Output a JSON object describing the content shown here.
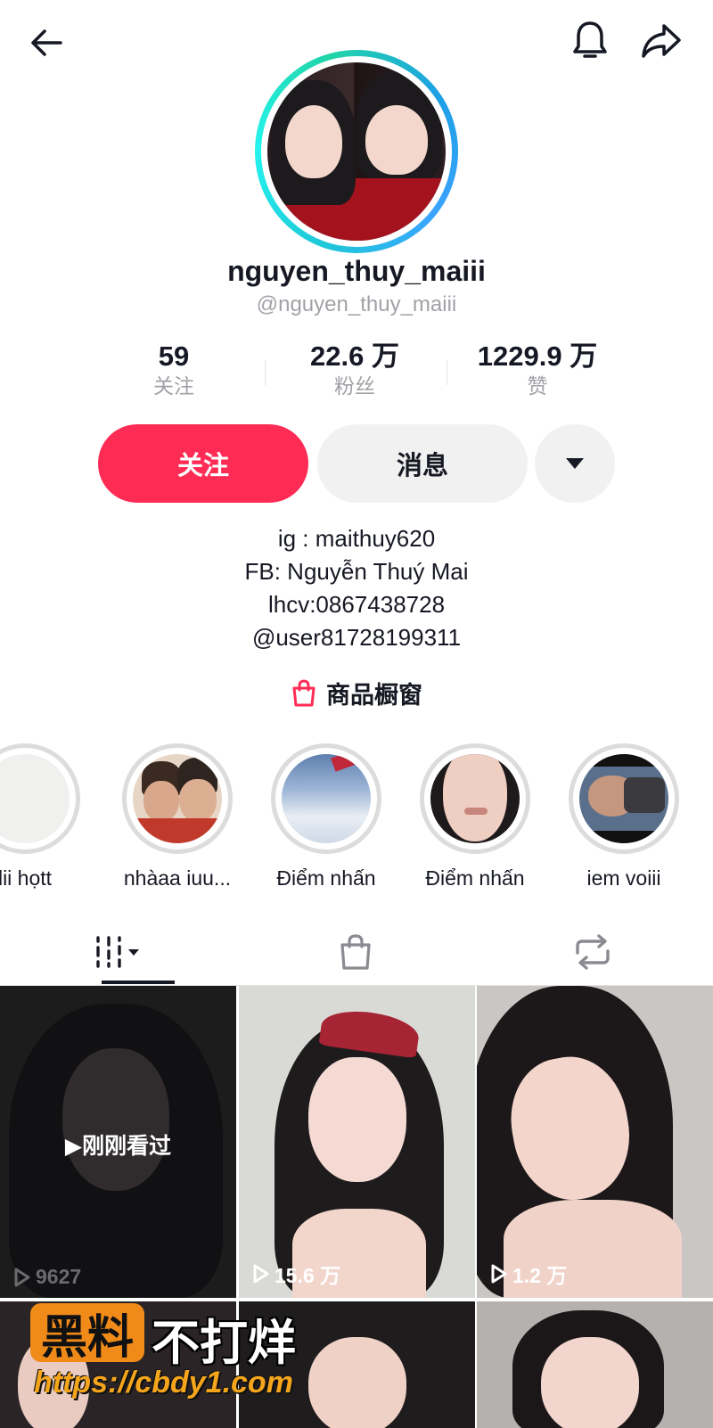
{
  "header": {
    "back_icon": "arrow-left-icon",
    "bell_icon": "bell-icon",
    "share_icon": "share-arrow-icon"
  },
  "profile": {
    "display_name": "nguyen_thuy_maiii",
    "handle": "@nguyen_thuy_maiii"
  },
  "stats": [
    {
      "value": "59",
      "label": "关注"
    },
    {
      "value": "22.6 万",
      "label": "粉丝"
    },
    {
      "value": "1229.9 万",
      "label": "赞"
    }
  ],
  "actions": {
    "follow_label": "关注",
    "message_label": "消息",
    "more_icon": "caret-down-icon"
  },
  "bio": [
    "ig : maithuy620",
    "FB: Nguyễn Thuý Mai",
    "lhcv:0867438728",
    "@user81728199311"
  ],
  "shop": {
    "label": "商品橱窗",
    "icon": "shopping-bag-icon"
  },
  "highlights": [
    {
      "label": "lii họtt"
    },
    {
      "label": "nhàaa iuu..."
    },
    {
      "label": "Điểm nhấn"
    },
    {
      "label": "Điểm nhấn"
    },
    {
      "label": "iem voiii"
    }
  ],
  "tabs": [
    {
      "name": "videos",
      "icon": "grid-columns-icon"
    },
    {
      "name": "shop",
      "icon": "shopping-bag-icon"
    },
    {
      "name": "reposts",
      "icon": "repost-icon"
    }
  ],
  "videos": [
    {
      "views": "9627",
      "overlay": "刚刚看过"
    },
    {
      "views": "15.6 万"
    },
    {
      "views": "1.2 万"
    }
  ],
  "watermark": {
    "badge": "黑料",
    "text": "不打烊",
    "url": "https://cbdy1.com"
  },
  "colors": {
    "accent": "#fe2c55",
    "secondary_button": "#f1f1f2",
    "muted_text": "#a1a2a7",
    "watermark_orange": "#f08b1a"
  }
}
